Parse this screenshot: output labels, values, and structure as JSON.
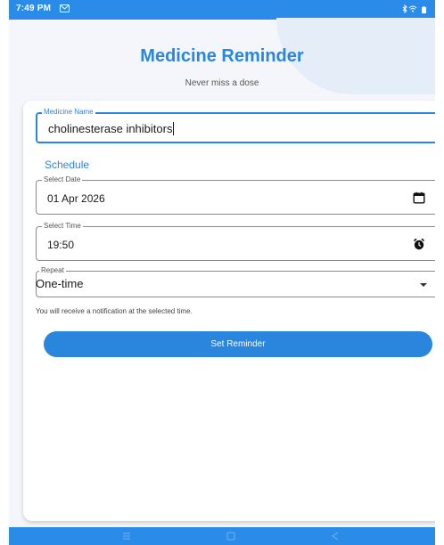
{
  "status_bar": {
    "time": "7:49 PM",
    "icons": [
      "message-icon",
      "bluetooth-icon",
      "wifi-icon",
      "battery-icon"
    ]
  },
  "header": {
    "title": "Medicine Reminder",
    "subtitle": "Never miss a dose"
  },
  "form": {
    "medicine": {
      "label": "Medicine Name",
      "value": "cholinesterase inhibitors"
    },
    "schedule_heading": "Schedule",
    "date": {
      "label": "Select Date",
      "value": "01 Apr 2026",
      "icon": "calendar-icon"
    },
    "time": {
      "label": "Select Time",
      "value": "19:50",
      "icon": "alarm-clock-icon"
    },
    "repeat": {
      "label": "Repeat",
      "value": "One-time",
      "icon": "dropdown-arrow-icon"
    },
    "helper_text": "You will receive a notification at the selected time.",
    "submit_label": "Set Reminder"
  },
  "nav_bar": {
    "icons": [
      "recents-icon",
      "home-icon",
      "back-icon"
    ]
  },
  "colors": {
    "accent": "#2a85dd",
    "system_bar": "#2b8be8",
    "background": "#f4f6fb",
    "card": "#ffffff"
  }
}
